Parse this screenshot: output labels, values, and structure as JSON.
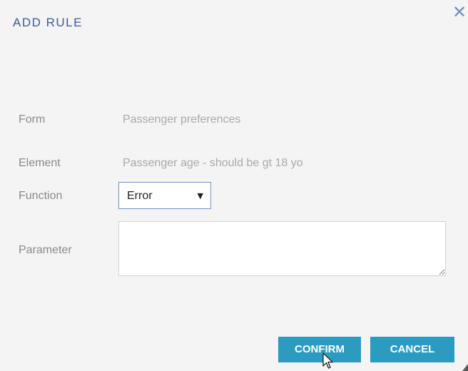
{
  "dialog": {
    "title": "ADD RULE",
    "close_icon": "close-icon"
  },
  "fields": {
    "form": {
      "label": "Form",
      "value": "Passenger preferences"
    },
    "element": {
      "label": "Element",
      "value": "Passenger age - should be gt 18 yo"
    },
    "function": {
      "label": "Function",
      "selected": "Error",
      "arrow": "▼"
    },
    "parameter": {
      "label": "Parameter",
      "value": ""
    }
  },
  "buttons": {
    "confirm": "CONFIRM",
    "cancel": "CANCEL"
  },
  "colors": {
    "title": "#3d5a99",
    "button": "#2b9bbf",
    "select_border": "#6d8fc7"
  }
}
